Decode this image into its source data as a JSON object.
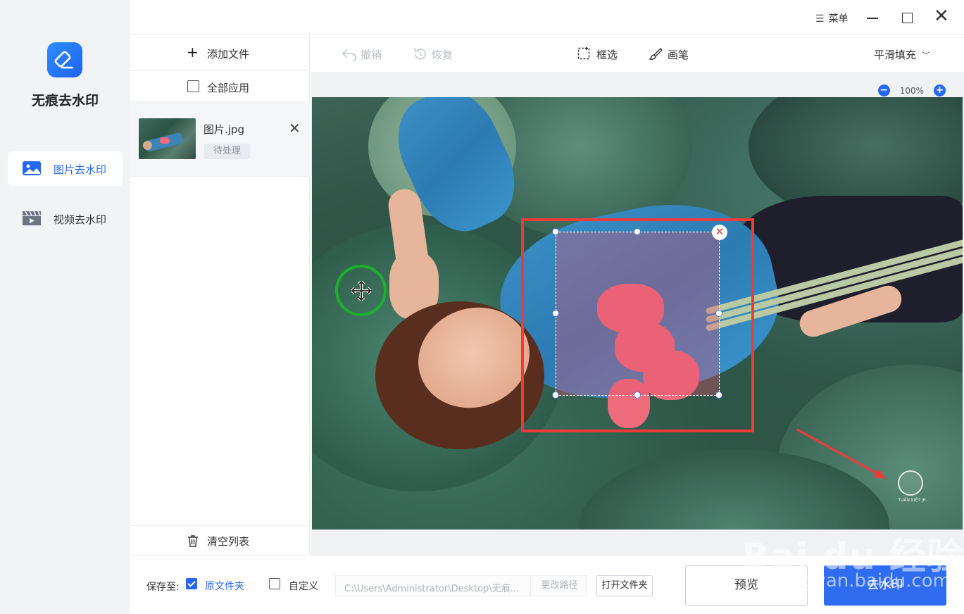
{
  "app": {
    "name": "无痕去水印"
  },
  "nav": {
    "items": [
      {
        "label": "图片去水印",
        "icon": "image-icon",
        "active": true
      },
      {
        "label": "视频去水印",
        "icon": "video-icon",
        "active": false
      }
    ]
  },
  "titlebar": {
    "menu_label": "菜单"
  },
  "filelist": {
    "add_label": "添加文件",
    "apply_all_label": "全部应用",
    "files": [
      {
        "name": "图片.jpg",
        "status": "待处理"
      }
    ],
    "clear_label": "清空列表"
  },
  "toolbar": {
    "undo_label": "撤销",
    "redo_label": "恢复",
    "box_select_label": "框选",
    "brush_label": "画笔",
    "fill_mode": "平滑填充"
  },
  "canvas": {
    "zoom_label": "100%",
    "watermark_text": "TUẤN KIỆT JR."
  },
  "bottombar": {
    "save_to_label": "保存至:",
    "original_folder_label": "原文件夹",
    "original_folder_checked": true,
    "custom_label": "自定义",
    "custom_checked": false,
    "path_value": "C:\\Users\\Administrator\\Desktop\\无痕...",
    "change_path_label": "更改路径",
    "open_folder_label": "打开文件夹",
    "preview_label": "预览",
    "remove_label": "去水印"
  },
  "overlay": {
    "baidu_text": "Bai du 经验",
    "baidu_url": "jingyan.baidu.com"
  },
  "colors": {
    "accent": "#2468f2",
    "annotation_red": "#ef3a3a",
    "annotation_green": "#1cb02d"
  }
}
